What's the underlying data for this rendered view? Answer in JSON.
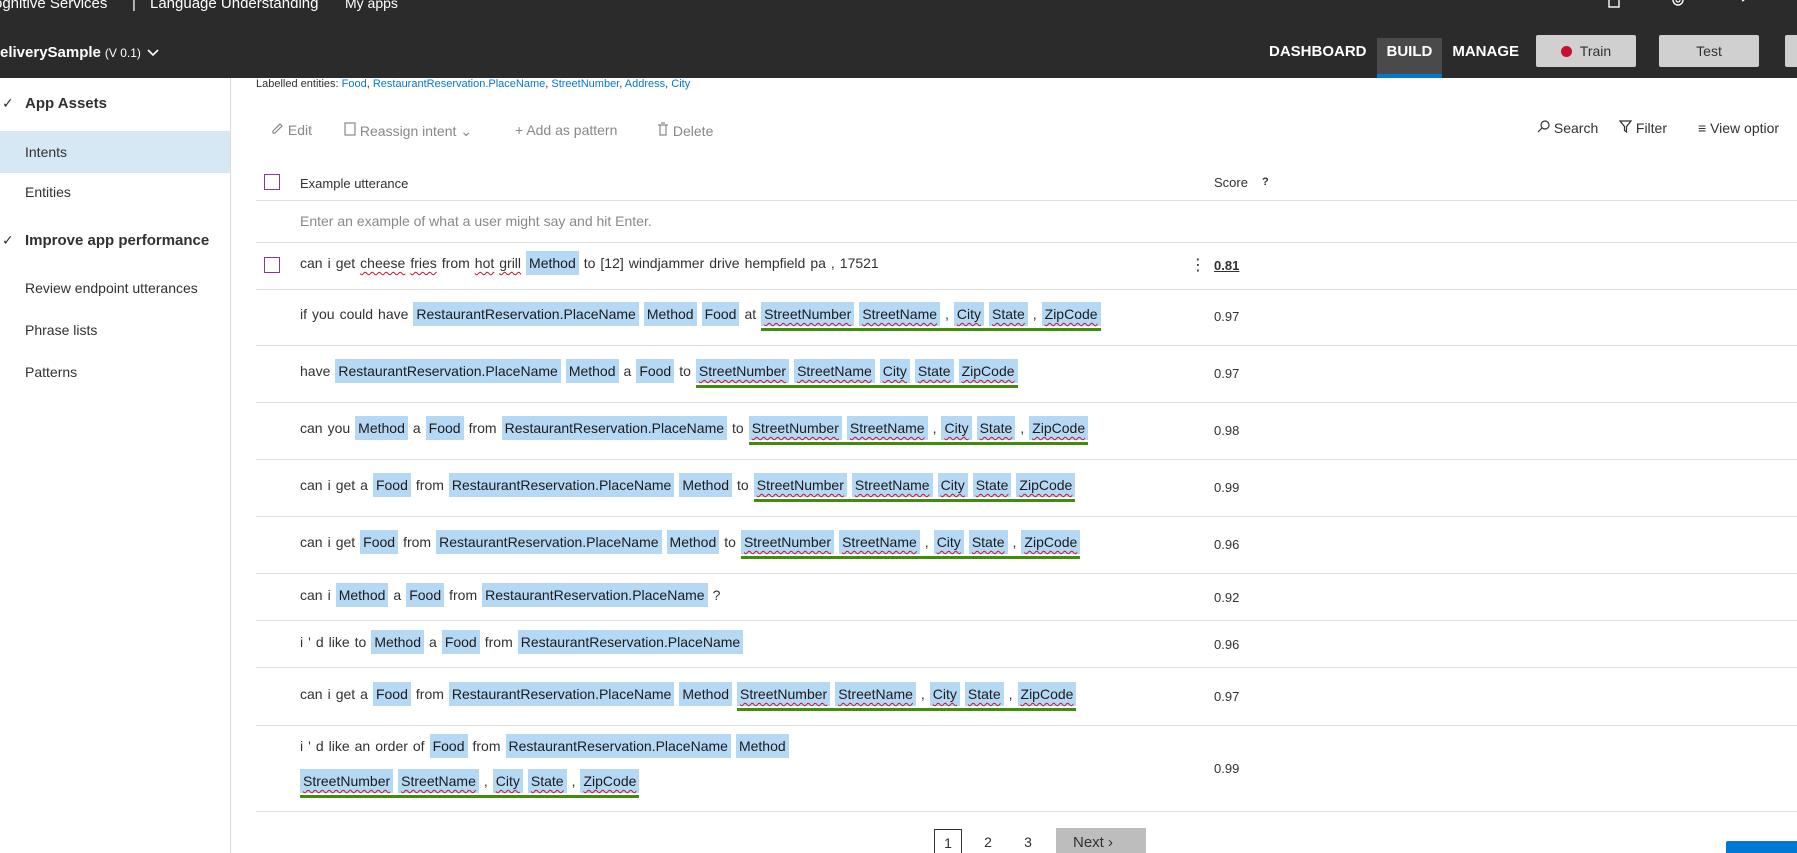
{
  "topbar": {
    "brand": "ognitive Services",
    "separator": "|",
    "product": "Language Understanding",
    "my_apps": "My apps",
    "app_name": "eliverySample",
    "app_version": "(V 0.1)",
    "nav": [
      "DASHBOARD",
      "BUILD",
      "MANAGE"
    ],
    "train_label": "Train",
    "test_label": "Test"
  },
  "sidebar": {
    "items": [
      {
        "label": "App Assets",
        "type": "section"
      },
      {
        "label": "Intents",
        "type": "item",
        "active": true
      },
      {
        "label": "Entities",
        "type": "item"
      },
      {
        "label": "Improve app performance",
        "type": "section"
      },
      {
        "label": "Review endpoint utterances",
        "type": "item"
      },
      {
        "label": "Phrase lists",
        "type": "item"
      },
      {
        "label": "Patterns",
        "type": "item"
      }
    ]
  },
  "labelled_entities": {
    "prefix": "Labelled entities:",
    "entities": [
      "Food",
      "RestaurantReservation.PlaceName",
      "StreetNumber",
      "Address",
      "City"
    ]
  },
  "toolbar": {
    "edit": "Edit",
    "reassign": "Reassign intent",
    "add_pattern": "Add as pattern",
    "delete": "Delete",
    "search": "Search",
    "filter": "Filter",
    "view_options": "View optior"
  },
  "table": {
    "col_utterance": "Example utterance",
    "col_score": "Score",
    "score_help": "?",
    "input_placeholder": "Enter an example of what a user might say and hit Enter.",
    "rows": [
      {
        "score": "0.81"
      },
      {
        "score": "0.97"
      },
      {
        "score": "0.97"
      },
      {
        "score": "0.98"
      },
      {
        "score": "0.99"
      },
      {
        "score": "0.96"
      },
      {
        "score": "0.92"
      },
      {
        "score": "0.96"
      },
      {
        "score": "0.97"
      },
      {
        "score": "0.99"
      }
    ]
  },
  "words": {
    "can": "can",
    "i": "i",
    "get": "get",
    "cheese": "cheese",
    "fries": "fries",
    "from": "from",
    "hot": "hot",
    "grill": "grill",
    "to": "to",
    "num12": "[12]",
    "windjammer": "windjammer",
    "drive": "drive",
    "hempfield": "hempfield",
    "pa": "pa",
    "comma": ",",
    "zip17521": "17521",
    "if": "if",
    "you": "you",
    "could": "could",
    "have": "have",
    "at": "at",
    "a": "a",
    "q": "?",
    "apos": "'",
    "d": "d",
    "like": "like",
    "an": "an",
    "order": "order",
    "of": "of"
  },
  "entities": {
    "method": "Method",
    "food": "Food",
    "place": "RestaurantReservation.PlaceName",
    "street_number": "StreetNumber",
    "street_name": "StreetName",
    "city": "City",
    "state": "State",
    "zip": "ZipCode"
  },
  "pager": {
    "pages": [
      "1",
      "2",
      "3"
    ],
    "next": "Next"
  },
  "colors": {
    "topbar": "#2b2b2b",
    "accent": "#0078d4",
    "entity_bg": "#b5d9f5",
    "group_underline": "#3e8e0c",
    "train_dot": "#c8102e"
  }
}
